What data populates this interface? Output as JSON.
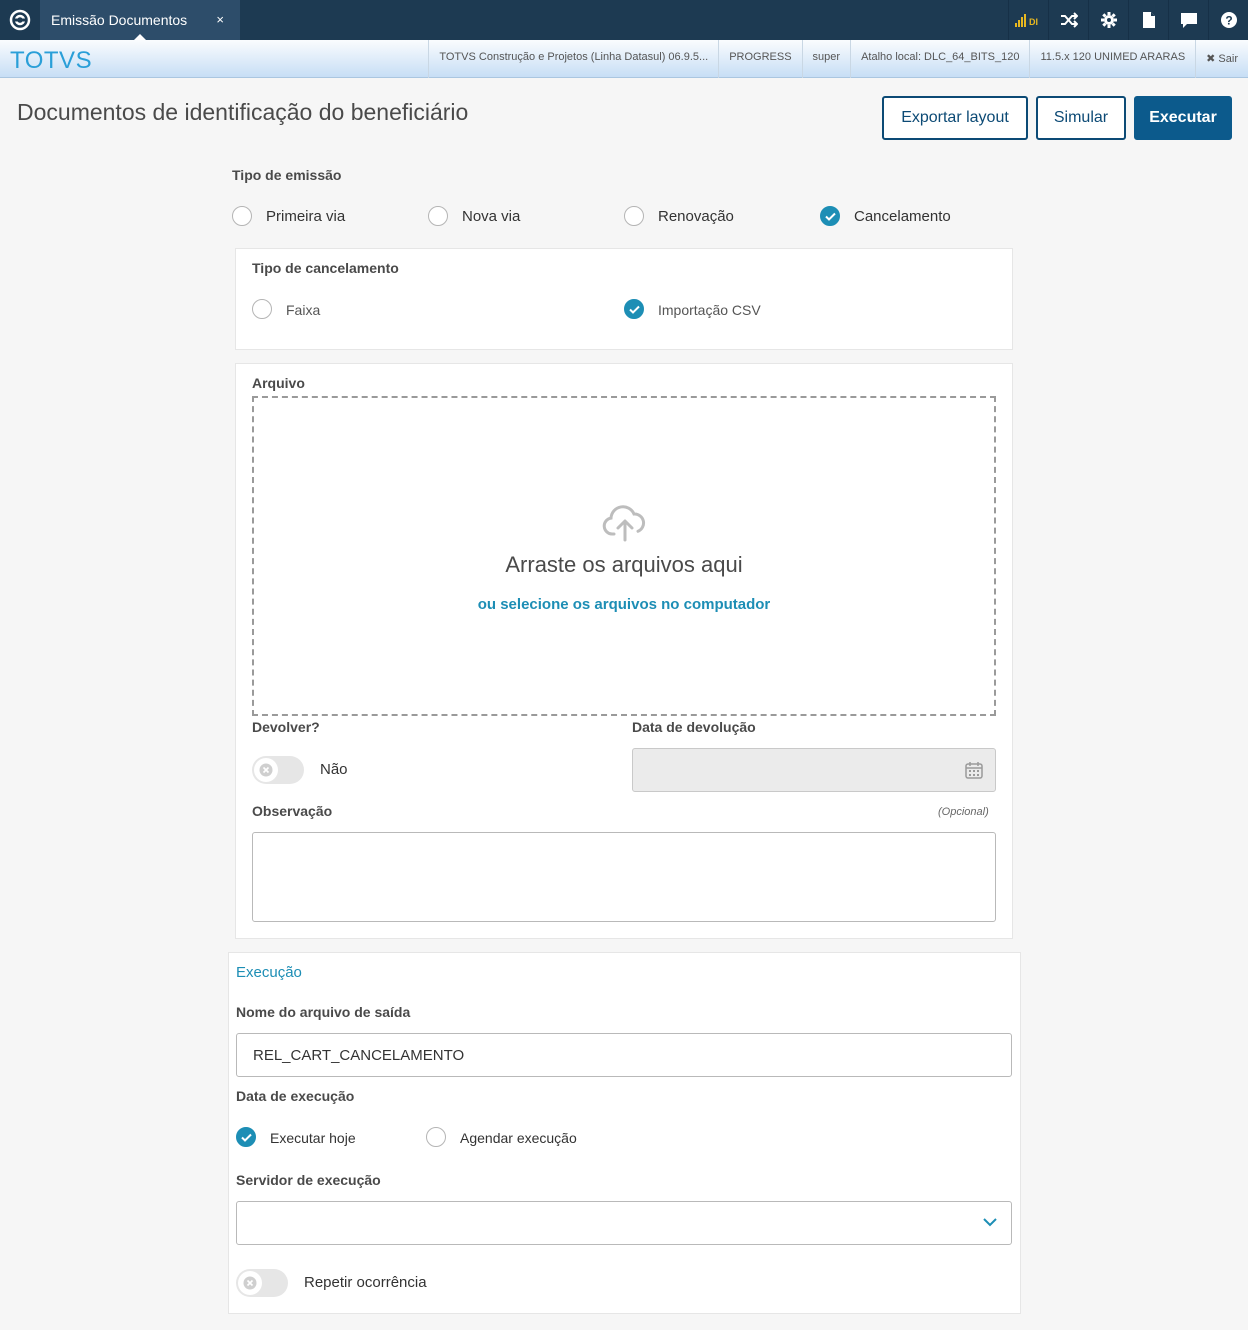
{
  "topbar": {
    "tab_label": "Emissão Documentos",
    "tab_close": "×",
    "signal_text": "DI"
  },
  "subbar": {
    "brand": "TOTVS",
    "info": [
      "TOTVS Construção e Projetos (Linha Datasul) 06.9.5...",
      "PROGRESS",
      "super",
      "Atalho local: DLC_64_BITS_120",
      "11.5.x 120 UNIMED ARARAS"
    ],
    "logout": "✖ Sair"
  },
  "header": {
    "title": "Documentos de identificação do beneficiário",
    "buttons": {
      "export": "Exportar layout",
      "simulate": "Simular",
      "execute": "Executar"
    }
  },
  "emission": {
    "label": "Tipo de emissão",
    "options": [
      "Primeira via",
      "Nova via",
      "Renovação",
      "Cancelamento"
    ],
    "selected": "Cancelamento"
  },
  "cancellation": {
    "label": "Tipo de cancelamento",
    "options": [
      "Faixa",
      "Importação CSV"
    ],
    "selected": "Importação CSV"
  },
  "file": {
    "label": "Arquivo",
    "drop_title": "Arraste os arquivos aqui",
    "drop_link": "ou selecione os arquivos no computador"
  },
  "return": {
    "label": "Devolver?",
    "toggle_text": "Não",
    "date_label": "Data de devolução"
  },
  "observation": {
    "label": "Observação",
    "optional": "(Opcional)",
    "value": ""
  },
  "execution": {
    "title": "Execução",
    "output_label": "Nome do arquivo de saída",
    "output_value": "REL_CART_CANCELAMENTO",
    "date_label": "Data de execução",
    "date_options": [
      "Executar hoje",
      "Agendar execução"
    ],
    "date_selected": "Executar hoje",
    "server_label": "Servidor de execução",
    "server_value": "",
    "repeat_label": "Repetir ocorrência"
  },
  "colors": {
    "topbar": "#1d3a52",
    "accent": "#1d8eb5",
    "primary_button": "#0c5a8c",
    "brand": "#2a9fd8"
  }
}
